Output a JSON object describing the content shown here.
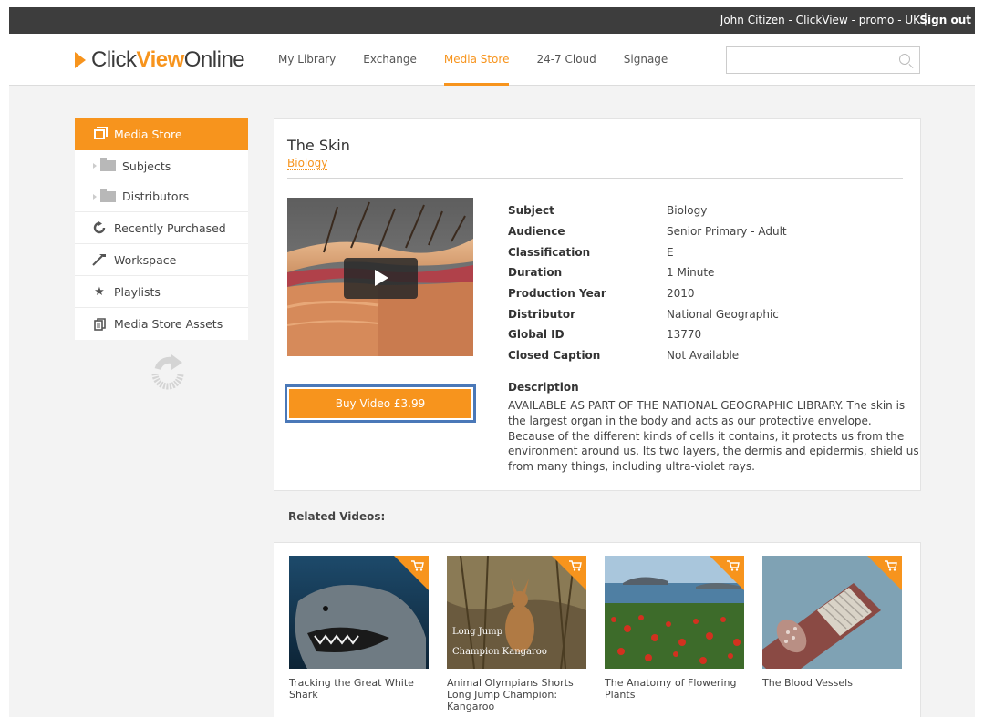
{
  "topbar": {
    "user": "John Citizen - ClickView - promo - UK",
    "separator": "|",
    "signout": "Sign out"
  },
  "logo": {
    "part1": "Click",
    "part2": "View",
    "part3": "Online"
  },
  "nav": {
    "items": [
      {
        "label": "My Library"
      },
      {
        "label": "Exchange"
      },
      {
        "label": "Media Store",
        "active": true
      },
      {
        "label": "24-7 Cloud"
      },
      {
        "label": "Signage"
      }
    ]
  },
  "search": {
    "value": "",
    "placeholder": ""
  },
  "sidebar": {
    "items": [
      {
        "label": "Media Store",
        "icon": "media-store-icon",
        "active": true
      },
      {
        "label": "Subjects",
        "icon": "folder-icon"
      },
      {
        "label": "Distributors",
        "icon": "folder-icon"
      },
      {
        "label": "Recently Purchased",
        "icon": "recent-icon"
      },
      {
        "label": "Workspace",
        "icon": "workspace-icon"
      },
      {
        "label": "Playlists",
        "icon": "star-icon"
      },
      {
        "label": "Media Store Assets",
        "icon": "assets-icon"
      }
    ]
  },
  "video": {
    "title": "The Skin",
    "subject_link": "Biology",
    "buy_label": "Buy Video £3.99",
    "meta": [
      {
        "key": "Subject",
        "value": "Biology"
      },
      {
        "key": "Audience",
        "value": "Senior Primary - Adult"
      },
      {
        "key": "Classification",
        "value": "E"
      },
      {
        "key": "Duration",
        "value": "1 Minute"
      },
      {
        "key": "Production Year",
        "value": "2010"
      },
      {
        "key": "Distributor",
        "value": "National Geographic"
      },
      {
        "key": "Global ID",
        "value": "13770"
      },
      {
        "key": "Closed Caption",
        "value": "Not Available"
      }
    ],
    "description_heading": "Description",
    "description": "AVAILABLE AS PART OF THE NATIONAL GEOGRAPHIC LIBRARY. The skin is the largest organ in the body and acts as our protective envelope. Because of the different kinds of cells it contains, it protects us from the environment around us. Its two layers, the dermis and epidermis, shield us from many things, including ultra-violet rays."
  },
  "related": {
    "heading": "Related Videos:",
    "items": [
      {
        "title": "Tracking the Great White Shark"
      },
      {
        "title": "Animal Olympians Shorts Long Jump Champion: Kangaroo",
        "overlay": [
          "Long Jump",
          "Champion Kangaroo"
        ]
      },
      {
        "title": "The Anatomy of Flowering Plants"
      },
      {
        "title": "The Blood Vessels"
      }
    ]
  },
  "colors": {
    "accent": "#f7941d",
    "topbar": "#3d3d3d",
    "highlight_border": "#4a78b8"
  }
}
